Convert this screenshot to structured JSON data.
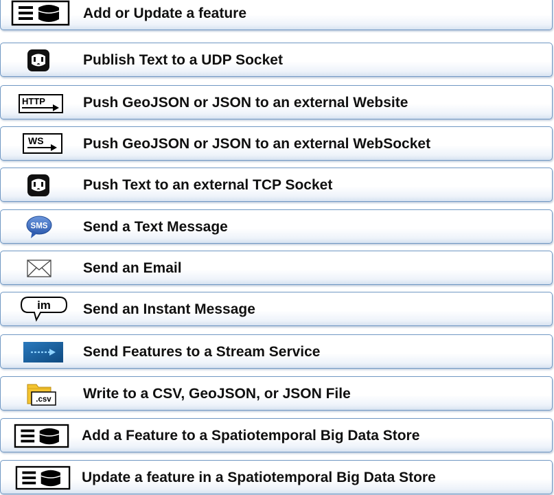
{
  "outputs": [
    {
      "label": "Add or Update a feature",
      "icon": "database-list-icon"
    },
    {
      "label": "Publish Text to a UDP Socket",
      "icon": "socket-outlet-icon"
    },
    {
      "label": "Push GeoJSON or JSON to an external Website",
      "icon": "http-icon",
      "icon_text": "HTTP"
    },
    {
      "label": "Push GeoJSON or JSON to an external WebSocket",
      "icon": "websocket-icon",
      "icon_text": "WS"
    },
    {
      "label": "Push Text to an external TCP Socket",
      "icon": "socket-outlet-icon"
    },
    {
      "label": "Send a Text Message",
      "icon": "sms-bubble-icon",
      "icon_text": "SMS"
    },
    {
      "label": "Send an Email",
      "icon": "envelope-icon"
    },
    {
      "label": "Send an Instant Message",
      "icon": "instant-message-icon",
      "icon_text": "im"
    },
    {
      "label": "Send Features to a Stream Service",
      "icon": "stream-service-icon"
    },
    {
      "label": "Write to a CSV, GeoJSON, or JSON File",
      "icon": "csv-folder-icon",
      "icon_text": ".csv"
    },
    {
      "label": "Add a Feature to a Spatiotemporal Big Data Store",
      "icon": "database-list-icon"
    },
    {
      "label": "Update a feature in a Spatiotemporal Big Data Store",
      "icon": "database-list-icon"
    }
  ],
  "colors": {
    "row_border": "#6f97c3",
    "sms_bubble": "#3d6fc4",
    "stream_tile": "#1a5f9a",
    "folder": "#f4c430"
  }
}
